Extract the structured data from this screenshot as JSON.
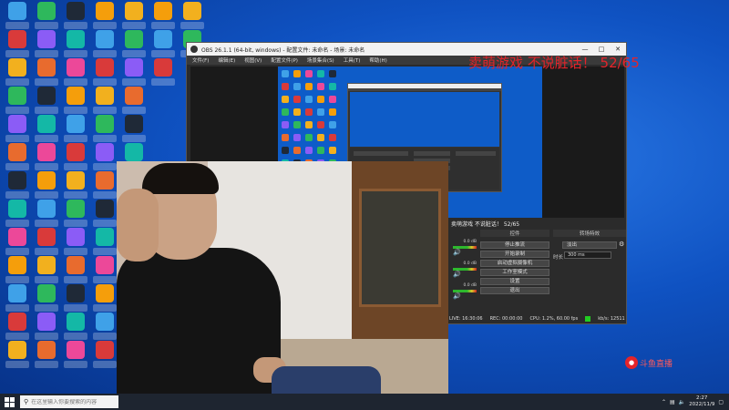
{
  "obs": {
    "title": "OBS 26.1.1 (64-bit, windows) - 配置文件: 未命名 - 场景: 未命名",
    "menu": [
      "文件(F)",
      "编辑(E)",
      "视图(V)",
      "配置文件(P)",
      "场景集合(S)",
      "工具(T)",
      "帮助(H)"
    ],
    "banner": "卖萌游戏 不说脏话！ 52/65",
    "controls_header": "控件",
    "transitions_header": "转场特效",
    "controls": [
      "停止推流",
      "开始录制",
      "启动虚拟摄像机",
      "工作室模式",
      "设置",
      "退出"
    ],
    "mixer_db": [
      "0.0 dB",
      "0.0 dB",
      "0.0 dB"
    ],
    "transition_type": "淡出",
    "duration_label": "时长",
    "duration_value": "300 ms",
    "status": {
      "live": "LIVE: 16:30:06",
      "rec": "REC: 00:00:00",
      "cpu": "CPU: 1.2%, 60.00 fps",
      "bitrate": "kb/s: 12511"
    }
  },
  "overlay": {
    "text": "卖萌游戏 不说脏话！ 52/65"
  },
  "watermark": {
    "text": "斗鱼直播"
  },
  "taskbar": {
    "search_placeholder": "在这里输入你要搜索的内容",
    "time": "2:27",
    "date": "2022/11/9"
  },
  "colors": {
    "overlay_red": "#e4242a",
    "desktop_blue": "#0f52c2",
    "obs_dark": "#2b2b2b",
    "live_green": "#22cc22"
  }
}
